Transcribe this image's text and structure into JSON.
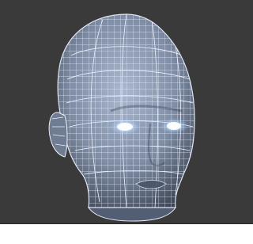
{
  "scene": {
    "subject": "wireframe-head-model",
    "background_color": "#3a3a3a",
    "mesh_fill_color": "#7f8ea6",
    "mesh_line_color": "#eef2ff",
    "eye_glow_color": "#dff2ff"
  }
}
